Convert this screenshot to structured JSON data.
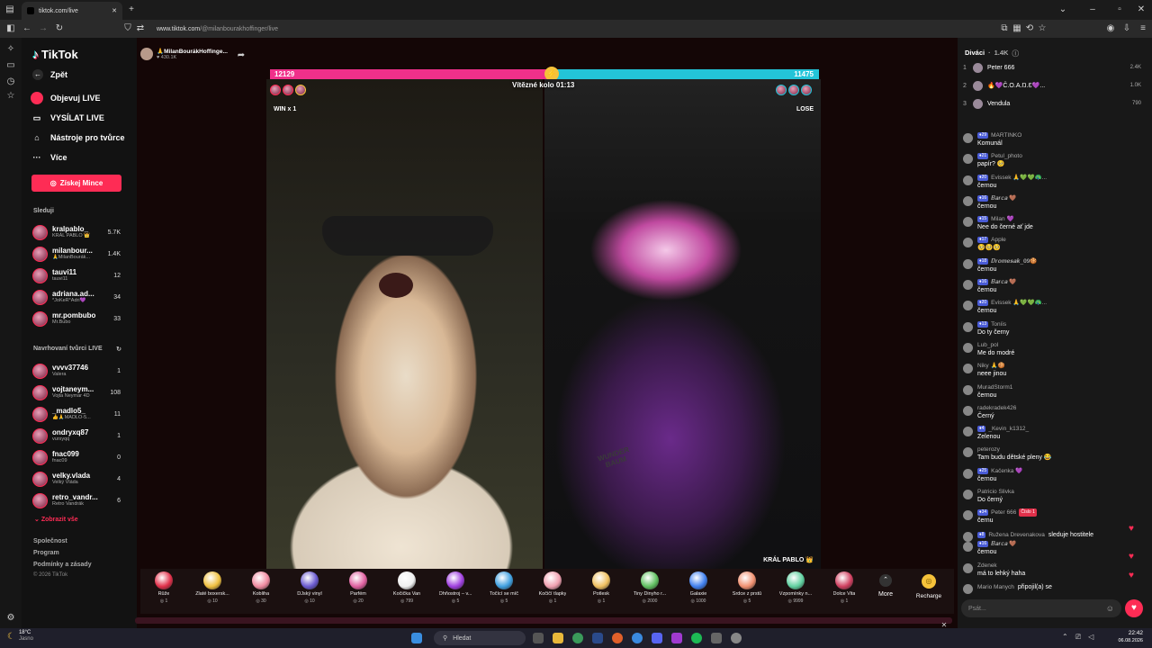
{
  "browser": {
    "tab_title": "tiktok.com/live",
    "url_host": "www.tiktok.com",
    "url_path": "/@milanbourakhoffinger/live"
  },
  "sidebar": {
    "logo": "TikTok",
    "back": "Zpět",
    "nav": [
      {
        "label": "Objevuj LIVE",
        "icon": "live-discover-icon"
      },
      {
        "label": "VYSÍLAT LIVE",
        "icon": "camera-icon"
      },
      {
        "label": "Nástroje pro tvůrce",
        "icon": "house-icon"
      },
      {
        "label": "Více",
        "icon": "more-icon"
      }
    ],
    "coins_button": "Získej Mince",
    "following_title": "Sleduji",
    "following": [
      {
        "name": "kralpablo_",
        "sub": "KRÁL PABLO 👑",
        "count": "5.7K"
      },
      {
        "name": "milanbour...",
        "sub": "🙏MilanBourák...",
        "count": "1.4K"
      },
      {
        "name": "tauvi11",
        "sub": "tauvi11",
        "count": "12"
      },
      {
        "name": "adriana.ad...",
        "sub": "*JoKeR*Adri💜",
        "count": "34"
      },
      {
        "name": "mr.pombubo",
        "sub": "Mr.Bubo",
        "count": "33"
      }
    ],
    "suggested_title": "Navrhovaní tvůrci LIVE",
    "suggested": [
      {
        "name": "vvvv37746",
        "sub": "Valera",
        "count": "1"
      },
      {
        "name": "vojtaneym...",
        "sub": "Vojta Neymar 4D",
        "count": "108"
      },
      {
        "name": "_madlo5_",
        "sub": "👍🙏MADLO-5...",
        "count": "11"
      },
      {
        "name": "ondryxq87",
        "sub": "vurxyqq",
        "count": "1"
      },
      {
        "name": "fnac099",
        "sub": "fnac09",
        "count": "0"
      },
      {
        "name": "velky.vlada",
        "sub": "Velký Vláda",
        "count": "4"
      },
      {
        "name": "retro_vandr...",
        "sub": "Retro Vandrák",
        "count": "6"
      }
    ],
    "show_all": "Zobrazit vše",
    "footer": [
      "Společnost",
      "Program",
      "Podmínky a zásady"
    ],
    "copyright": "© 2026 TikTok"
  },
  "stream": {
    "host_name": "🙏MilanBourákHoffinge...",
    "host_likes": "430.1K",
    "score_left": "12129",
    "score_right": "11475",
    "round_label": "Vítězné kolo 01:13",
    "left_status": "WIN x 1",
    "right_status": "LOSE",
    "right_name": "KRÁL PABLO 👑",
    "bag_text1": "WUNDER",
    "bag_text2": "BAUM"
  },
  "gifts": [
    {
      "name": "Růže",
      "price": "1",
      "color": "#e0304a"
    },
    {
      "name": "Zlaté boxersk...",
      "price": "10",
      "color": "#f0c040"
    },
    {
      "name": "Kobliha",
      "price": "30",
      "color": "#f08aa0"
    },
    {
      "name": "DJský vinyl",
      "price": "10",
      "color": "#6a5ad0"
    },
    {
      "name": "Parfém",
      "price": "20",
      "color": "#e060a0"
    },
    {
      "name": "Kočička Van",
      "price": "799",
      "color": "#f0f0f0"
    },
    {
      "name": "Ohňostroj – v...",
      "price": "5",
      "color": "#a040e0"
    },
    {
      "name": "Točící se míč",
      "price": "5",
      "color": "#40a0e0"
    },
    {
      "name": "Kočičí tlapky",
      "price": "1",
      "color": "#f0a0b0"
    },
    {
      "name": "Potlesk",
      "price": "1",
      "color": "#f0c060"
    },
    {
      "name": "Tiny Dinyho r...",
      "price": "2000",
      "color": "#60c060"
    },
    {
      "name": "Galaxie",
      "price": "1000",
      "color": "#4080f0"
    },
    {
      "name": "Srdce z prstů",
      "price": "5",
      "color": "#f09070"
    },
    {
      "name": "Vzpomínky n...",
      "price": "9999",
      "color": "#60d0a0"
    },
    {
      "name": "Dolce Vita",
      "price": "1",
      "color": "#d04060"
    }
  ],
  "more_label": "More",
  "recharge_label": "Recharge",
  "chat": {
    "viewers_title": "Diváci",
    "viewers_count": "1.4K",
    "top": [
      {
        "rank": "1",
        "name": "Peter 666",
        "score": "2.4K"
      },
      {
        "rank": "2",
        "name": "🔥💜Č.O.A.Ŋ.Ɛ💜...",
        "score": "1.0K"
      },
      {
        "rank": "3",
        "name": "Vendula",
        "score": "790"
      }
    ],
    "messages": [
      {
        "lvl": "29",
        "name": "MARTINKO",
        "text": "Komunál"
      },
      {
        "lvl": "21",
        "name": "Petul_photo",
        "text": "papír? 🥺"
      },
      {
        "lvl": "20",
        "name": "Evissek 🙏💚💚🦚...",
        "text": "černou"
      },
      {
        "lvl": "16",
        "name": "𝑩𝒂𝒓𝒄𝒂 🤎",
        "text": "černou"
      },
      {
        "lvl": "15",
        "name": "Milan 💜",
        "text": "Nee do černé ať jde"
      },
      {
        "lvl": "17",
        "name": "Apple",
        "text": "🥺🥺🥺"
      },
      {
        "lvl": "18",
        "name": "𝑫𝒓𝒐𝒎𝒆𝒔𝒂𝒌_𝟎𝟗🍪",
        "text": "černou"
      },
      {
        "lvl": "16",
        "name": "𝑩𝒂𝒓𝒄𝒂 🤎",
        "text": "černou"
      },
      {
        "lvl": "20",
        "name": "Evissek 🙏💚💚🦚...",
        "text": "černou"
      },
      {
        "lvl": "13",
        "name": "Toníis",
        "text": "Do ty černy"
      },
      {
        "lvl": "",
        "name": "Lub_pol",
        "text": "Me do modré"
      },
      {
        "lvl": "",
        "name": "Niky 🙏🍪",
        "text": "neee jinou"
      },
      {
        "lvl": "",
        "name": "MuradStorm1",
        "text": "černou"
      },
      {
        "lvl": "",
        "name": "radekradek426",
        "text": "Černý"
      },
      {
        "lvl": "4",
        "name": "_Kevin_k1312_",
        "text": "Zelenou"
      },
      {
        "lvl": "",
        "name": "peterozy",
        "text": "Tam budu dětské pleny 😂"
      },
      {
        "lvl": "25",
        "name": "Kačenka 💜",
        "text": "černou"
      },
      {
        "lvl": "",
        "name": "Patricio Slivka",
        "text": "Do černý"
      },
      {
        "lvl": "34",
        "name": "Peter 666",
        "text": "černu"
      },
      {
        "lvl": "8",
        "name": "Ružena Drevenakova",
        "text": "sleduje hostitele"
      },
      {
        "lvl": "16",
        "name": "𝑩𝒂𝒓𝒄𝒂 🤎",
        "text": "černou"
      },
      {
        "lvl": "",
        "name": "Zdenek",
        "text": "má to lehký haha"
      },
      {
        "lvl": "",
        "name": "Mario Manych",
        "text": "připojil(a) se"
      }
    ],
    "peter_badge": "Číslo 1",
    "input_placeholder": "Psát..."
  },
  "taskbar": {
    "weather_temp": "18°C",
    "weather_desc": "Jasno",
    "search": "Hledat",
    "time": "22:42",
    "date": "06.08.2026"
  }
}
